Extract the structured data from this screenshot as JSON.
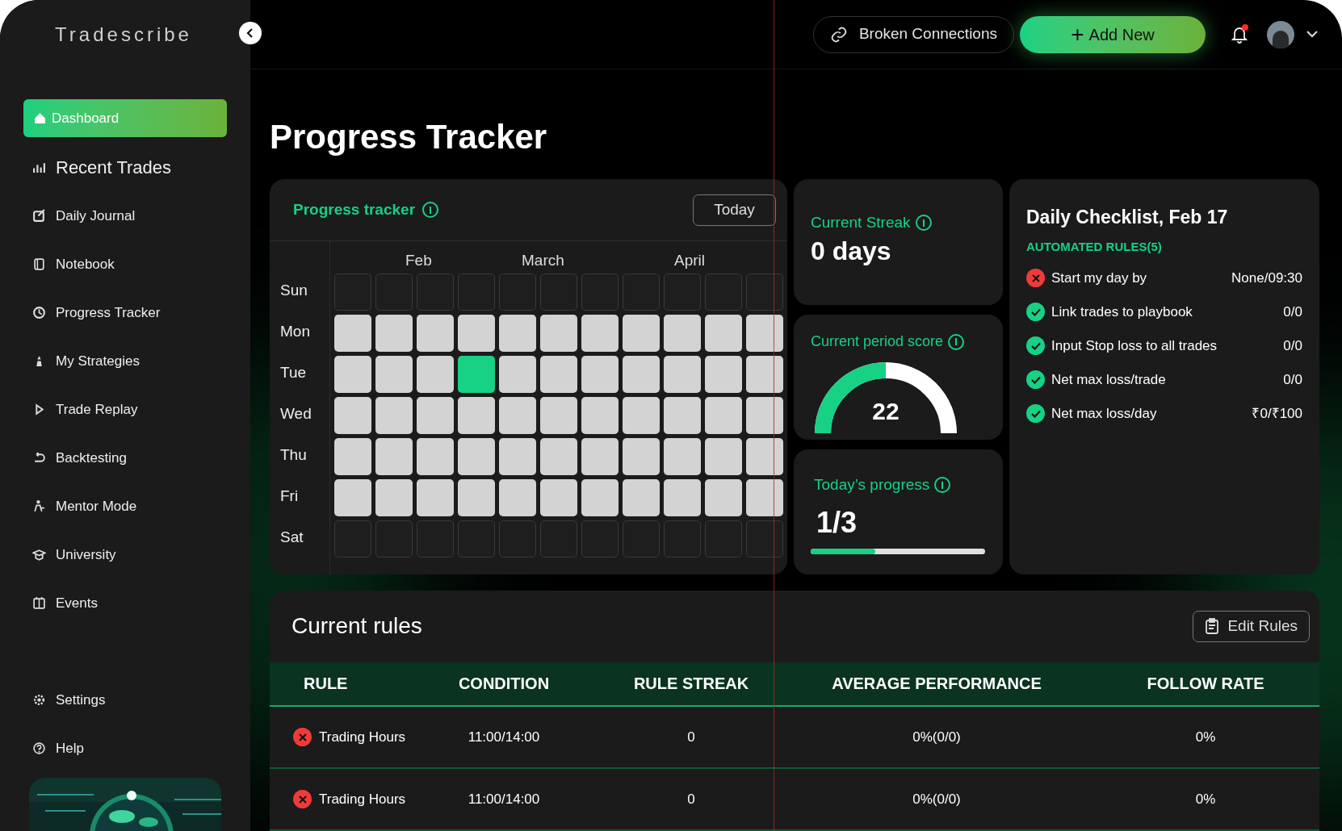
{
  "sidebar": {
    "logo": "Tradescribe",
    "items": [
      {
        "label": "Dashboard",
        "selected": true
      },
      {
        "label": "Recent Trades",
        "selected": false
      },
      {
        "label": "Daily Journal",
        "selected": false
      },
      {
        "label": "Notebook",
        "selected": false
      },
      {
        "label": "Progress Tracker",
        "selected": false
      },
      {
        "label": "My Strategies",
        "selected": false
      },
      {
        "label": "Trade Replay",
        "selected": false
      },
      {
        "label": "Backtesting",
        "selected": false
      },
      {
        "label": "Mentor Mode",
        "selected": false
      },
      {
        "label": "University",
        "selected": false
      },
      {
        "label": "Events",
        "selected": false
      }
    ],
    "footer_items": [
      {
        "label": "Settings"
      },
      {
        "label": "Help"
      }
    ]
  },
  "top_bar": {
    "broken_connections": "Broken Connections",
    "add_new": "Add New",
    "add_new_icon": "+",
    "notifications_unread": true
  },
  "page_title": "Progress Tracker",
  "tracker": {
    "title": "Progress tracker",
    "today_button": "Today",
    "months": [
      "Feb",
      "March",
      "April"
    ],
    "rows": [
      {
        "day": "Sun",
        "cells": [
          {
            "kind": "none"
          },
          {
            "kind": "none"
          },
          {
            "kind": "none"
          },
          {
            "kind": "none"
          },
          {
            "kind": "none"
          },
          {
            "kind": "none"
          },
          {
            "kind": "none"
          },
          {
            "kind": "none"
          },
          {
            "kind": "none"
          },
          {
            "kind": "none"
          },
          {
            "kind": "none"
          }
        ]
      },
      {
        "day": "Mon",
        "cells": [
          {
            "kind": "open"
          },
          {
            "kind": "open"
          },
          {
            "kind": "open"
          },
          {
            "kind": "open"
          },
          {
            "kind": "open"
          },
          {
            "kind": "open"
          },
          {
            "kind": "open"
          },
          {
            "kind": "open"
          },
          {
            "kind": "open"
          },
          {
            "kind": "open"
          },
          {
            "kind": "open"
          }
        ]
      },
      {
        "day": "Tue",
        "cells": [
          {
            "kind": "open"
          },
          {
            "kind": "open"
          },
          {
            "kind": "open"
          },
          {
            "kind": "done"
          },
          {
            "kind": "open"
          },
          {
            "kind": "open"
          },
          {
            "kind": "open"
          },
          {
            "kind": "open"
          },
          {
            "kind": "open"
          },
          {
            "kind": "open"
          },
          {
            "kind": "open"
          }
        ]
      },
      {
        "day": "Wed",
        "cells": [
          {
            "kind": "open"
          },
          {
            "kind": "open"
          },
          {
            "kind": "open"
          },
          {
            "kind": "open"
          },
          {
            "kind": "open"
          },
          {
            "kind": "open"
          },
          {
            "kind": "open"
          },
          {
            "kind": "open"
          },
          {
            "kind": "open"
          },
          {
            "kind": "open"
          },
          {
            "kind": "open"
          }
        ]
      },
      {
        "day": "Thu",
        "cells": [
          {
            "kind": "open"
          },
          {
            "kind": "open"
          },
          {
            "kind": "open"
          },
          {
            "kind": "open"
          },
          {
            "kind": "open"
          },
          {
            "kind": "open"
          },
          {
            "kind": "open"
          },
          {
            "kind": "open"
          },
          {
            "kind": "open"
          },
          {
            "kind": "open"
          },
          {
            "kind": "open"
          }
        ]
      },
      {
        "day": "Fri",
        "cells": [
          {
            "kind": "open"
          },
          {
            "kind": "open"
          },
          {
            "kind": "open"
          },
          {
            "kind": "open"
          },
          {
            "kind": "open"
          },
          {
            "kind": "open"
          },
          {
            "kind": "open"
          },
          {
            "kind": "open"
          },
          {
            "kind": "open"
          },
          {
            "kind": "open"
          },
          {
            "kind": "open"
          }
        ]
      },
      {
        "day": "Sat",
        "cells": [
          {
            "kind": "none"
          },
          {
            "kind": "none"
          },
          {
            "kind": "none"
          },
          {
            "kind": "none"
          },
          {
            "kind": "none"
          },
          {
            "kind": "none"
          },
          {
            "kind": "none"
          },
          {
            "kind": "none"
          },
          {
            "kind": "none"
          },
          {
            "kind": "none"
          },
          {
            "kind": "none"
          }
        ]
      }
    ]
  },
  "streak": {
    "label": "Current Streak",
    "value": "0 days"
  },
  "period_score": {
    "label": "Current period score",
    "value": "22",
    "level": 0.5
  },
  "todays_progress": {
    "label": "Today’s progress",
    "value": "1/3",
    "level": 0.37
  },
  "checklist": {
    "title": "Daily Checklist, Feb 17",
    "subtitle": "AUTOMATED RULES(5)",
    "items": [
      {
        "label": "Start my day by",
        "value": "None/09:30",
        "passed": false
      },
      {
        "label": "Link trades to playbook",
        "value": "0/0",
        "passed": true
      },
      {
        "label": "Input Stop loss to all trades",
        "value": "0/0",
        "passed": true
      },
      {
        "label": "Net max loss/trade",
        "value": "0/0",
        "passed": true
      },
      {
        "label": "Net max loss/day",
        "value": "₹0/₹100",
        "passed": true
      }
    ]
  },
  "rules": {
    "title": "Current rules",
    "edit_button": "Edit Rules",
    "columns": [
      "RULE",
      "CONDITION",
      "RULE STREAK",
      "AVERAGE PERFORMANCE",
      "FOLLOW RATE"
    ],
    "rows": [
      {
        "rule": "Trading Hours",
        "passed": false,
        "condition": "11:00/14:00",
        "streak": "0",
        "average_performance": "0%(0/0)",
        "follow_rate": "0%"
      },
      {
        "rule": "Trading Hours",
        "passed": false,
        "condition": "11:00/14:00",
        "streak": "0",
        "average_performance": "0%(0/0)",
        "follow_rate": "0%"
      }
    ]
  }
}
